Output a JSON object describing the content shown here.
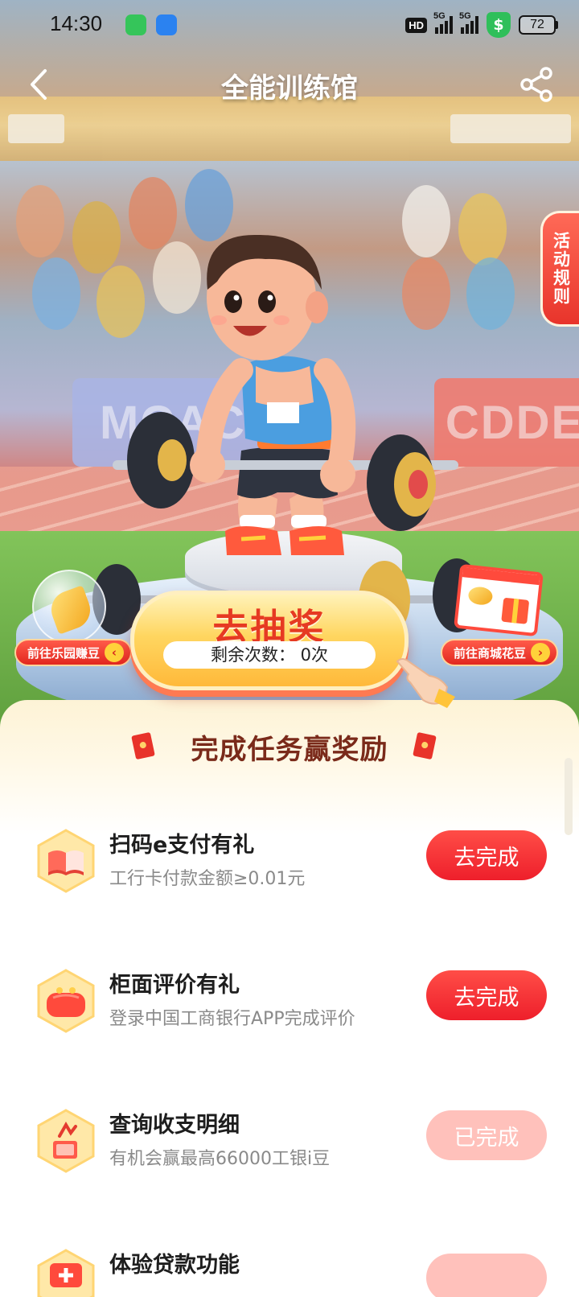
{
  "status_bar": {
    "time": "14:30",
    "hd_label": "HD",
    "signal_1_label": "5G",
    "signal_2_label": "5G",
    "shield_symbol": "$",
    "battery": "72"
  },
  "nav": {
    "title": "全能训练馆",
    "back_icon": "chevron-left-icon",
    "share_icon": "share-icon"
  },
  "hero": {
    "banner_left_text": "MCAC",
    "banner_right_text": "CDDE",
    "rules_label": "活动规则",
    "left_pill": "前往乐园赚豆",
    "right_pill": "前往商城花豆",
    "draw_button": {
      "title": "去抽奖",
      "remaining_label": "剩余次数：",
      "remaining_value": "0次"
    }
  },
  "task_panel": {
    "title": "完成任务赢奖励",
    "tasks": [
      {
        "name": "扫码e支付有礼",
        "desc": "工行卡付款金额≥0.01元",
        "button": "去完成",
        "status": "todo",
        "icon": "book-icon"
      },
      {
        "name": "柜面评价有礼",
        "desc": "登录中国工商银行APP完成评价",
        "button": "去完成",
        "status": "todo",
        "icon": "wallet-icon"
      },
      {
        "name": "查询收支明细",
        "desc": "有机会赢最高66000工银i豆",
        "button": "已完成",
        "status": "done",
        "icon": "chart-icon"
      },
      {
        "name": "体验贷款功能",
        "desc": "",
        "button": "",
        "status": "todo",
        "icon": "loan-icon"
      }
    ]
  },
  "colors": {
    "primary_red": "#ee1f2b",
    "done_pink": "#ffc1bb",
    "title_brown": "#7a2a1a",
    "draw_yellow": "#ffd660"
  }
}
